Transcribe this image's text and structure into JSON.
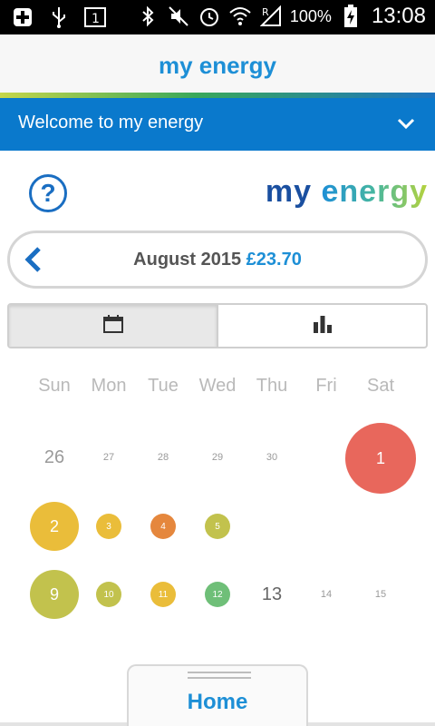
{
  "status_bar": {
    "battery_percent": "100%",
    "time": "13:08",
    "icons": [
      "add-icon",
      "usb-icon",
      "sim-icon",
      "bluetooth-icon",
      "mute-icon",
      "alarm-icon",
      "wifi-icon",
      "signal-icon",
      "battery-charging-icon"
    ]
  },
  "app_bar": {
    "title": "my energy"
  },
  "welcome": {
    "text": "Welcome to my energy"
  },
  "logo": {
    "part1": "my ",
    "part2": "energy"
  },
  "month_selector": {
    "month": "August 2015",
    "amount": "£23.70"
  },
  "calendar": {
    "weekdays": [
      "Sun",
      "Mon",
      "Tue",
      "Wed",
      "Thu",
      "Fri",
      "Sat"
    ],
    "days": [
      {
        "label": "26"
      },
      {
        "label": "27"
      },
      {
        "label": "28"
      },
      {
        "label": "29"
      },
      {
        "label": "30"
      },
      {
        "label": "1"
      },
      {
        "label": "2"
      },
      {
        "label": "3"
      },
      {
        "label": "4"
      },
      {
        "label": "5"
      },
      {
        "label": "9"
      },
      {
        "label": "10"
      },
      {
        "label": "11"
      },
      {
        "label": "12"
      },
      {
        "label": "13"
      },
      {
        "label": "14"
      },
      {
        "label": "15"
      }
    ]
  },
  "bottom": {
    "home_label": "Home"
  },
  "colors": {
    "accent": "#1d8fd6",
    "header_blue": "#0a79cc",
    "red": "#e8675c",
    "yellow": "#eabd3a",
    "orange": "#e5873d",
    "olive": "#c2c24d",
    "green": "#6fbf78"
  }
}
